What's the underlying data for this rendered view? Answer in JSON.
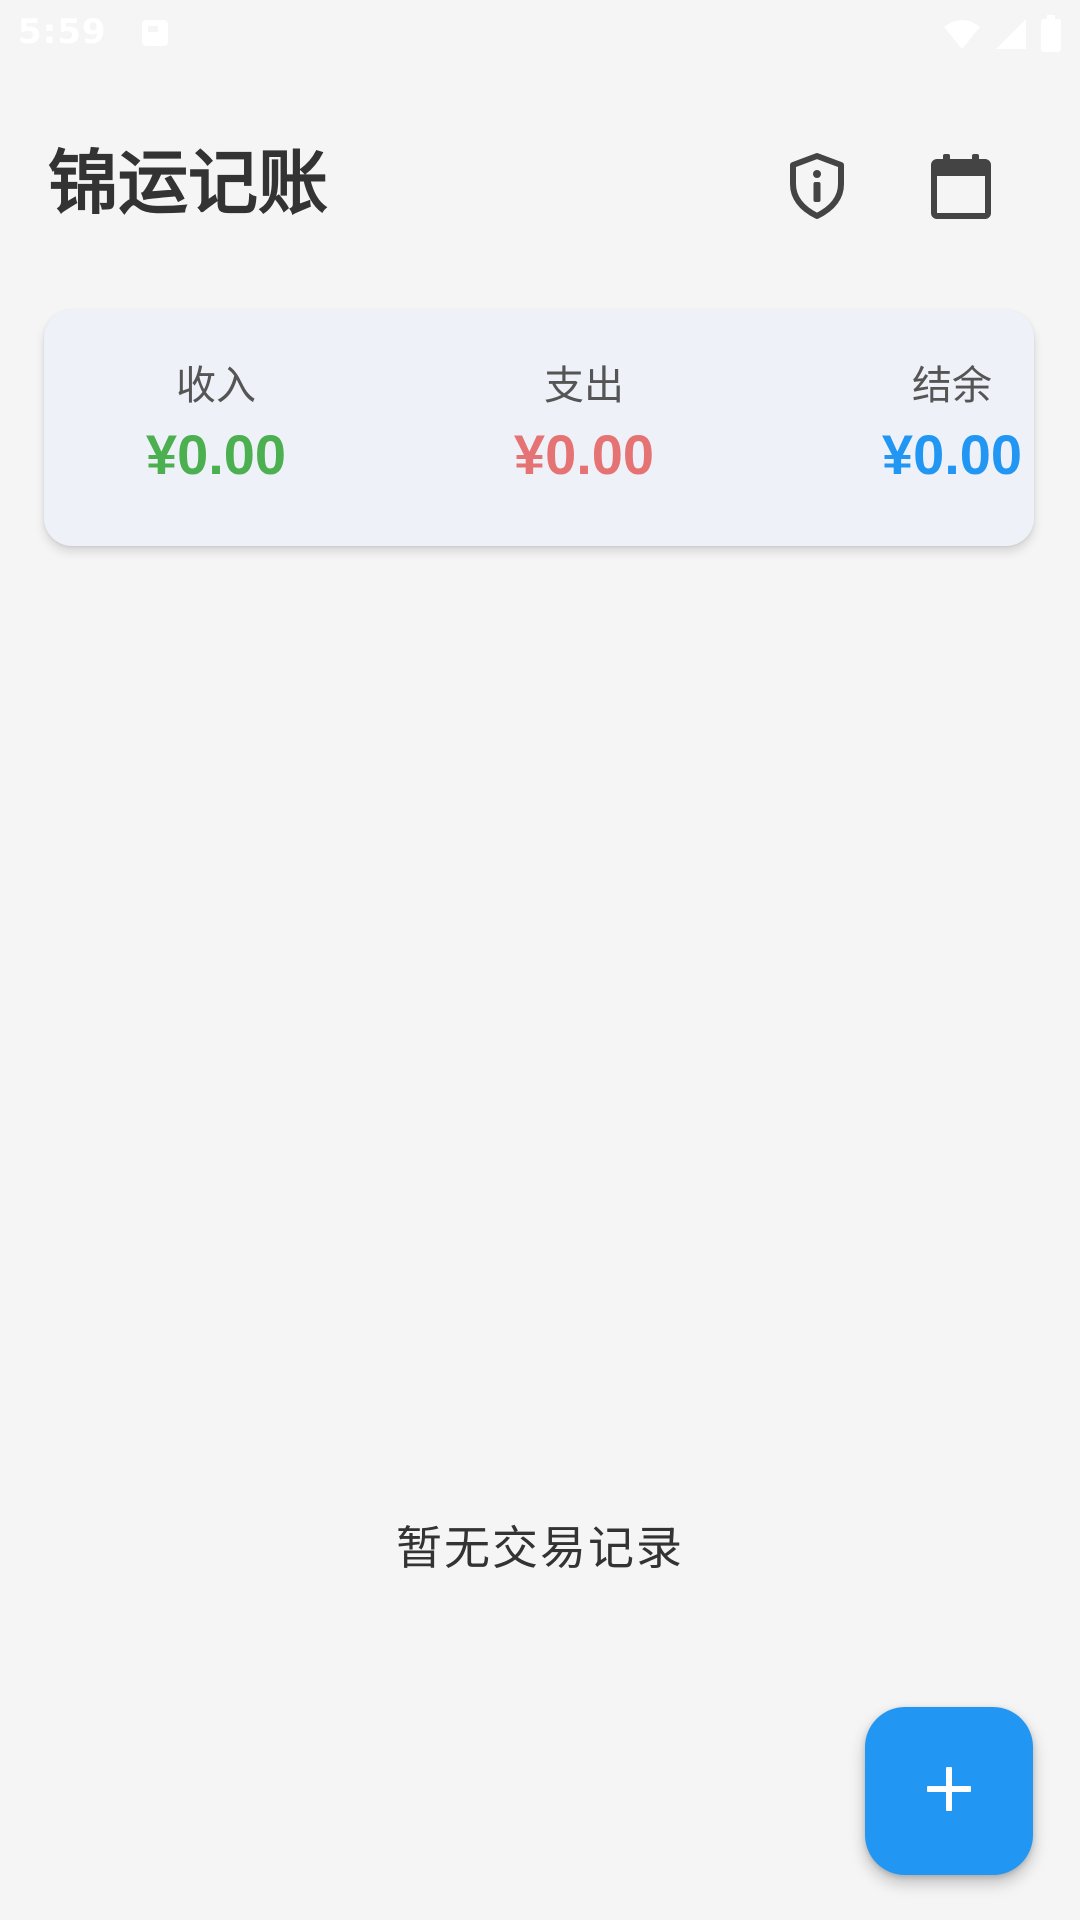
{
  "status_bar": {
    "time": "5:59",
    "icons": [
      "notification-icon",
      "wifi-icon",
      "signal-icon",
      "battery-icon"
    ]
  },
  "header": {
    "title": "锦运记账",
    "icons": [
      "shield-info-icon",
      "calendar-icon"
    ]
  },
  "summary": {
    "income": {
      "label": "收入",
      "value": "¥0.00",
      "color": "#4caf50"
    },
    "expense": {
      "label": "支出",
      "value": "¥0.00",
      "color": "#e57373"
    },
    "balance": {
      "label": "结余",
      "value": "¥0.00",
      "color": "#2196f3"
    }
  },
  "empty_state": {
    "message": "暂无交易记录"
  },
  "fab": {
    "icon": "plus-icon",
    "color": "#2196f3"
  }
}
